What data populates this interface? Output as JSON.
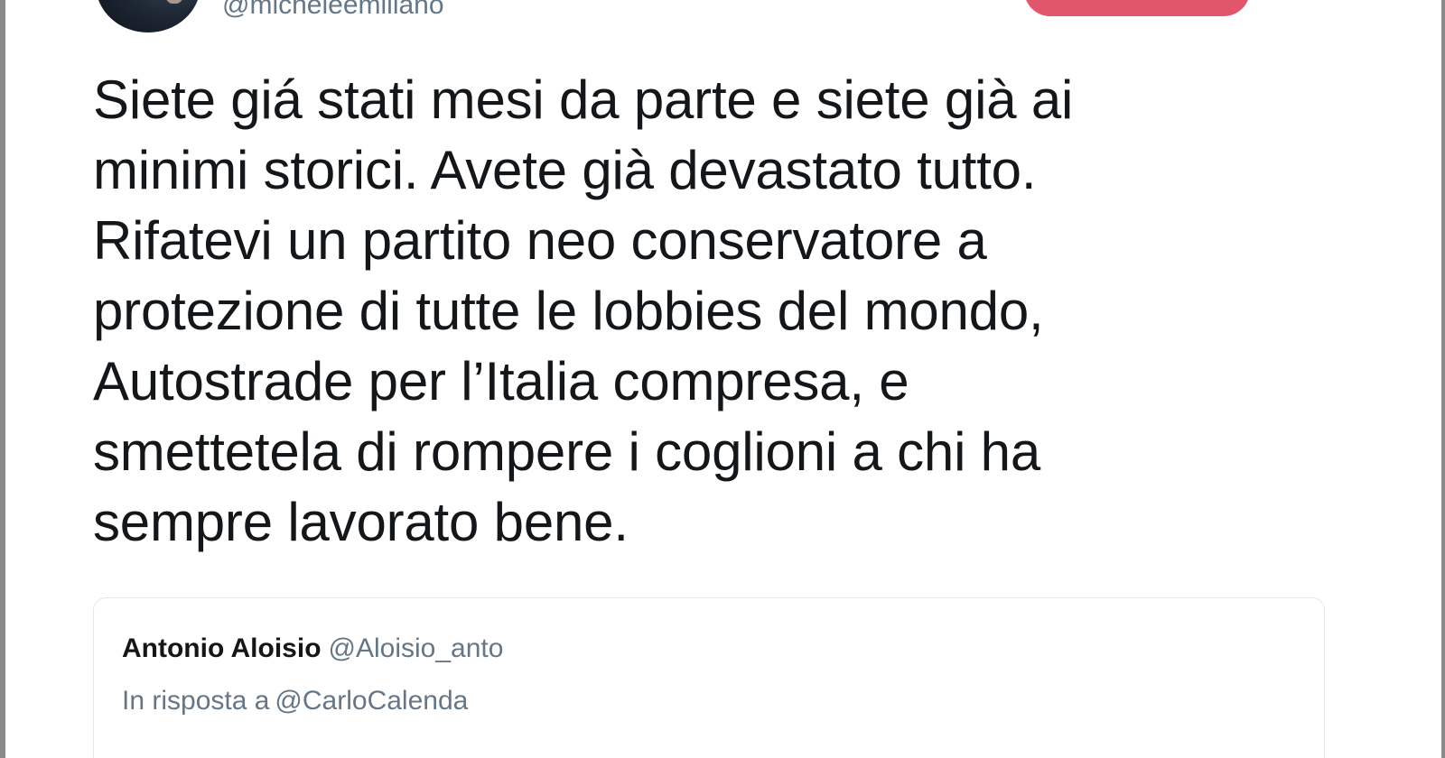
{
  "author": {
    "handle": "@micheleemiliano"
  },
  "tweet": {
    "lines": [
      "Siete giá stati mesi da parte e siete già ai",
      "minimi storici. Avete già devastato tutto.",
      "Rifatevi un partito neo conservatore a",
      "protezione di tutte le lobbies del mondo,",
      "Autostrade per l’Italia compresa, e",
      "smettetela di rompere i coglioni a chi ha",
      "sempre lavorato bene."
    ]
  },
  "quoted_tweet": {
    "name": "Antonio Aloisio",
    "handle": "@Aloisio_anto",
    "reply_prefix": "In risposta a",
    "reply_to": "@CarloCalenda"
  },
  "colors": {
    "follow_button": "#e0566b",
    "secondary_text": "#657786",
    "primary_text": "#14171a",
    "card_border": "#e1e8ed"
  }
}
